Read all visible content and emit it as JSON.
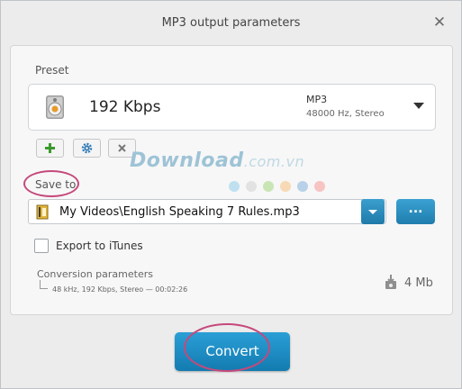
{
  "window": {
    "title": "MP3 output parameters",
    "close_glyph": "✕"
  },
  "preset": {
    "label": "Preset",
    "bitrate": "192 Kbps",
    "format": "MP3",
    "details": "48000 Hz,  Stereo",
    "icon": "speaker-icon"
  },
  "preset_actions": {
    "add_icon": "plus-icon",
    "settings_icon": "gear-icon",
    "remove_icon": "close-icon"
  },
  "watermark": {
    "main": "Download",
    "suffix": ".com.vn"
  },
  "save_to": {
    "label": "Save to",
    "path": "My Videos\\English Speaking 7 Rules.mp3",
    "browse_label": "...",
    "file_icon": "audio-file-icon"
  },
  "color_dots": [
    "#bfe0f0",
    "#e2e2e2",
    "#c9e5b5",
    "#f7d9b5",
    "#b9d1e8",
    "#f7c3c3"
  ],
  "export": {
    "label": "Export to iTunes",
    "checked": false
  },
  "conversion": {
    "title": "Conversion parameters",
    "details": "48 kHz, 192 Kbps, Stereo — 00:02:26",
    "size": "4 Mb",
    "size_icon": "file-size-icon"
  },
  "convert": {
    "label": "Convert"
  },
  "colors": {
    "accent": "#1f86bb",
    "highlight_ring": "#c5497c"
  }
}
